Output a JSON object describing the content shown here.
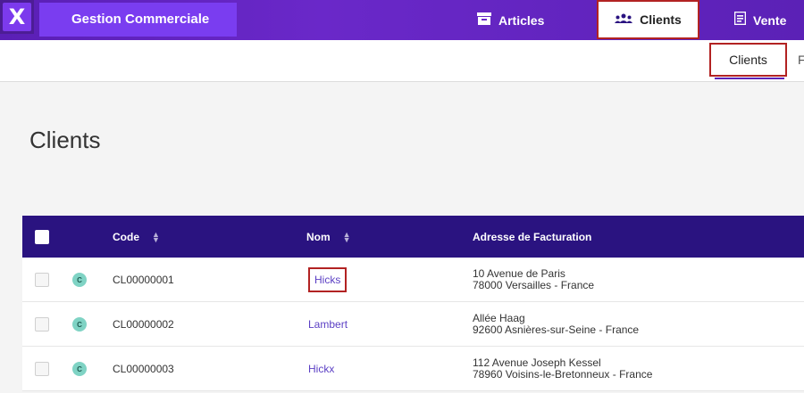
{
  "app": {
    "logo_letter": "X",
    "title": "Gestion Commerciale"
  },
  "nav": {
    "articles": "Articles",
    "clients": "Clients",
    "ventes": "Vente"
  },
  "subnav": {
    "active": "Clients",
    "next_partial": "F"
  },
  "page": {
    "title": "Clients"
  },
  "table": {
    "headers": {
      "code": "Code",
      "nom": "Nom",
      "adresse": "Adresse de Facturation"
    },
    "rows": [
      {
        "badge": "C",
        "code": "CL00000001",
        "nom": "Hicks",
        "addr1": "10 Avenue de Paris",
        "addr2": "78000 Versailles - France"
      },
      {
        "badge": "C",
        "code": "CL00000002",
        "nom": "Lambert",
        "addr1": "Allée Haag",
        "addr2": "92600 Asnières-sur-Seine - France"
      },
      {
        "badge": "C",
        "code": "CL00000003",
        "nom": "Hickx",
        "addr1": "112 Avenue Joseph Kessel",
        "addr2": "78960 Voisins-le-Bretonneux - France"
      }
    ]
  },
  "colors": {
    "brand": "#6a28c9",
    "table_header": "#2a1380",
    "link": "#5b3fc4",
    "highlight": "#b22222"
  }
}
